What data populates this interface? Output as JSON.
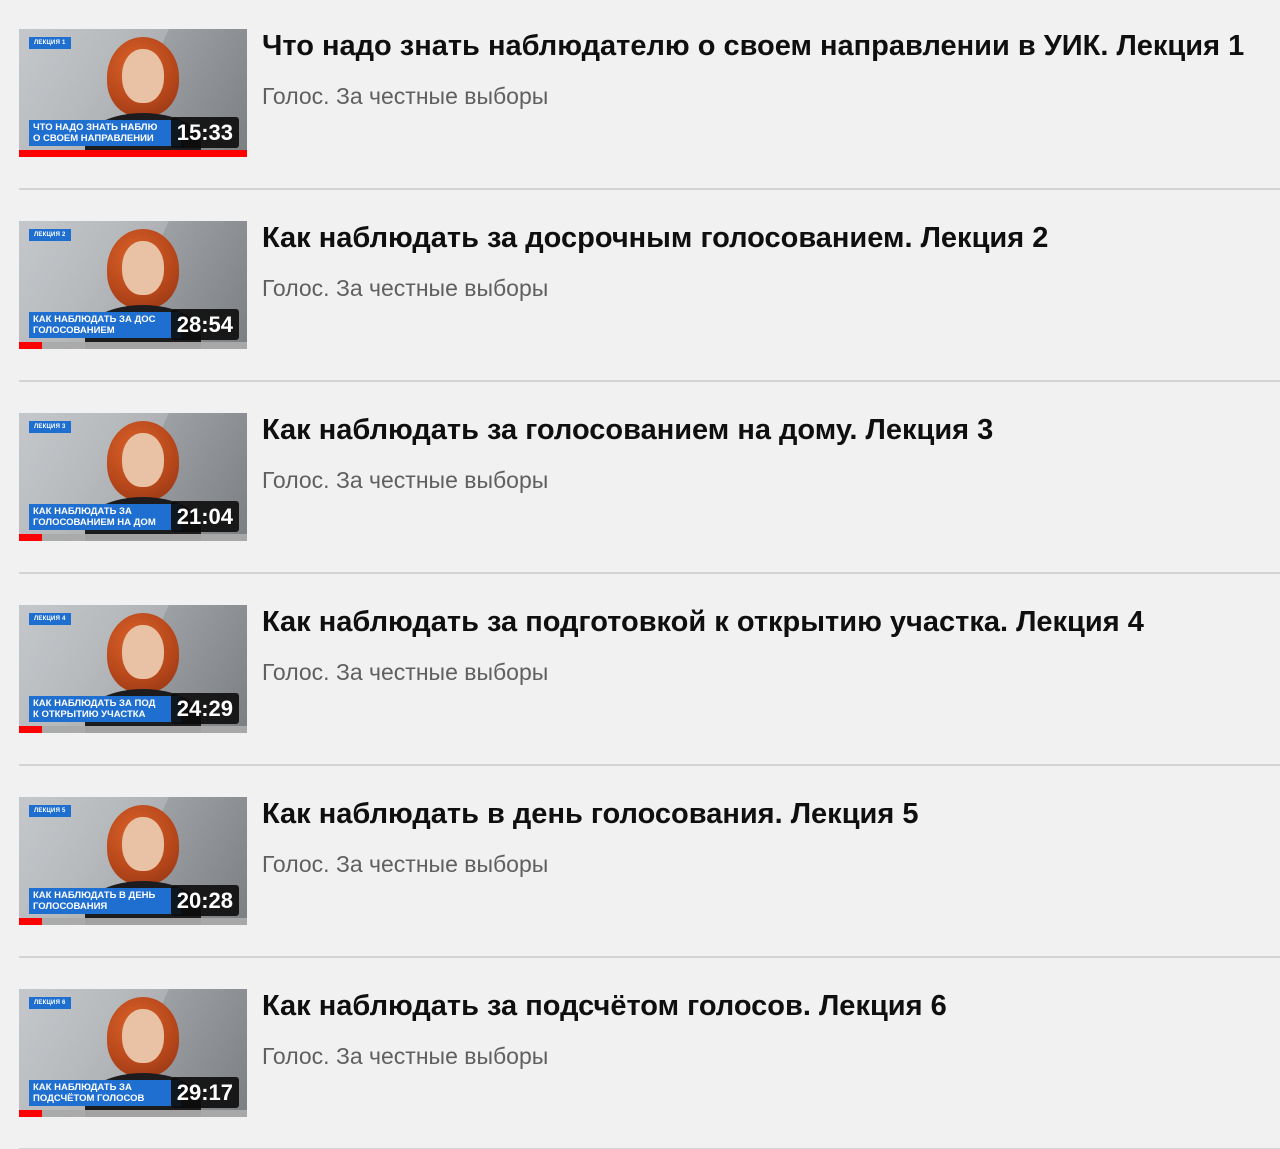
{
  "playlist": {
    "items": [
      {
        "title": "Что надо знать наблюдателю о своем направлении в УИК. Лекция 1",
        "channel": "Голос. За честные выборы",
        "duration": "15:33",
        "badge": "ЛЕКЦИЯ 1",
        "caption_line1": "ЧТО НАДО ЗНАТЬ НАБЛЮ",
        "caption_line2": "О СВОЕМ НАПРАВЛЕНИИ",
        "progress": 1.0
      },
      {
        "title": "Как наблюдать за досрочным голосованием. Лекция 2",
        "channel": "Голос. За честные выборы",
        "duration": "28:54",
        "badge": "ЛЕКЦИЯ 2",
        "caption_line1": "КАК НАБЛЮДАТЬ ЗА ДОС",
        "caption_line2": "ГОЛОСОВАНИЕМ",
        "progress": 0.1
      },
      {
        "title": "Как наблюдать за голосованием на дому. Лекция 3",
        "channel": "Голос. За честные выборы",
        "duration": "21:04",
        "badge": "ЛЕКЦИЯ 3",
        "caption_line1": "КАК НАБЛЮДАТЬ ЗА",
        "caption_line2": "ГОЛОСОВАНИЕМ НА ДОМ",
        "progress": 0.1
      },
      {
        "title": "Как наблюдать за подготовкой к открытию участка. Лекция 4",
        "channel": "Голос. За честные выборы",
        "duration": "24:29",
        "badge": "ЛЕКЦИЯ 4",
        "caption_line1": "КАК НАБЛЮДАТЬ ЗА ПОД",
        "caption_line2": "К ОТКРЫТИЮ УЧАСТКА",
        "progress": 0.1
      },
      {
        "title": "Как наблюдать в день голосования. Лекция 5",
        "channel": "Голос. За честные выборы",
        "duration": "20:28",
        "badge": "ЛЕКЦИЯ 5",
        "caption_line1": "КАК НАБЛЮДАТЬ В ДЕНЬ",
        "caption_line2": "ГОЛОСОВАНИЯ",
        "progress": 0.1
      },
      {
        "title": "Как наблюдать за подсчётом голосов. Лекция 6",
        "channel": "Голос. За честные выборы",
        "duration": "29:17",
        "badge": "ЛЕКЦИЯ 6",
        "caption_line1": "КАК НАБЛЮДАТЬ ЗА",
        "caption_line2": "ПОДСЧЁТОМ ГОЛОСОВ",
        "progress": 0.1
      }
    ]
  },
  "colors": {
    "background": "#f1f1f1",
    "title": "#0f0f0f",
    "channel": "#606060",
    "progress": "#ff0000",
    "caption_bg": "#1f6fd1"
  }
}
